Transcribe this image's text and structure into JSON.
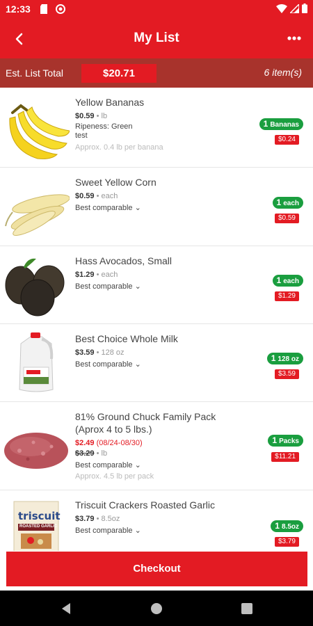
{
  "status_bar": {
    "time": "12:33"
  },
  "header": {
    "title": "My List",
    "back_icon": "back-arrow-icon",
    "more_icon": "more-dots-icon"
  },
  "summary": {
    "label": "Est. List Total",
    "total": "$20.71",
    "count": "6 item(s)"
  },
  "items": [
    {
      "name": "Yellow Bananas",
      "price": "$0.59",
      "unit": " • lb",
      "meta1": "Ripeness: Green",
      "meta2": "test",
      "approx": "Approx. 0.4 lb per banana",
      "qty_n": "1",
      "qty_unit": "Bananas",
      "subtotal": "$0.24",
      "image": "banana"
    },
    {
      "name": "Sweet Yellow Corn",
      "price": "$0.59",
      "unit": " • each",
      "comparable": "Best comparable",
      "qty_n": "1",
      "qty_unit": "each",
      "subtotal": "$0.59",
      "image": "corn"
    },
    {
      "name": "Hass Avocados, Small",
      "price": "$1.29",
      "unit": " • each",
      "comparable": "Best comparable",
      "qty_n": "1",
      "qty_unit": "each",
      "subtotal": "$1.29",
      "image": "avocado"
    },
    {
      "name": "Best Choice Whole Milk",
      "price": "$3.59",
      "unit": " • 128 oz",
      "comparable": "Best comparable",
      "qty_n": "1",
      "qty_unit": "128 oz",
      "subtotal": "$3.59",
      "image": "milk"
    },
    {
      "name_line1": "81% Ground Chuck Family Pack",
      "name_line2": "(Aprox 4 to 5 lbs.)",
      "sale_price": "$2.49",
      "sale_dates": "(08/24-08/30)",
      "regular_price": "$3.29",
      "unit": " • lb",
      "comparable": "Best comparable",
      "approx": "Approx. 4.5 lb per pack",
      "qty_n": "1",
      "qty_unit": "Packs",
      "subtotal": "$11.21",
      "image": "ground-beef"
    },
    {
      "name": "Triscuit Crackers Roasted Garlic",
      "price": "$3.79",
      "unit": " • 8.5oz",
      "comparable": "Best comparable",
      "qty_n": "1",
      "qty_unit": "8.5oz",
      "subtotal": "$3.79",
      "image": "crackers",
      "brand": "triscuit",
      "flavor": "ROASTED GARLIC"
    }
  ],
  "checkout": {
    "label": "Checkout"
  },
  "colors": {
    "brand": "#e31b23",
    "summary_bar": "#a8332c",
    "quantity_badge": "#1a9e3f"
  }
}
